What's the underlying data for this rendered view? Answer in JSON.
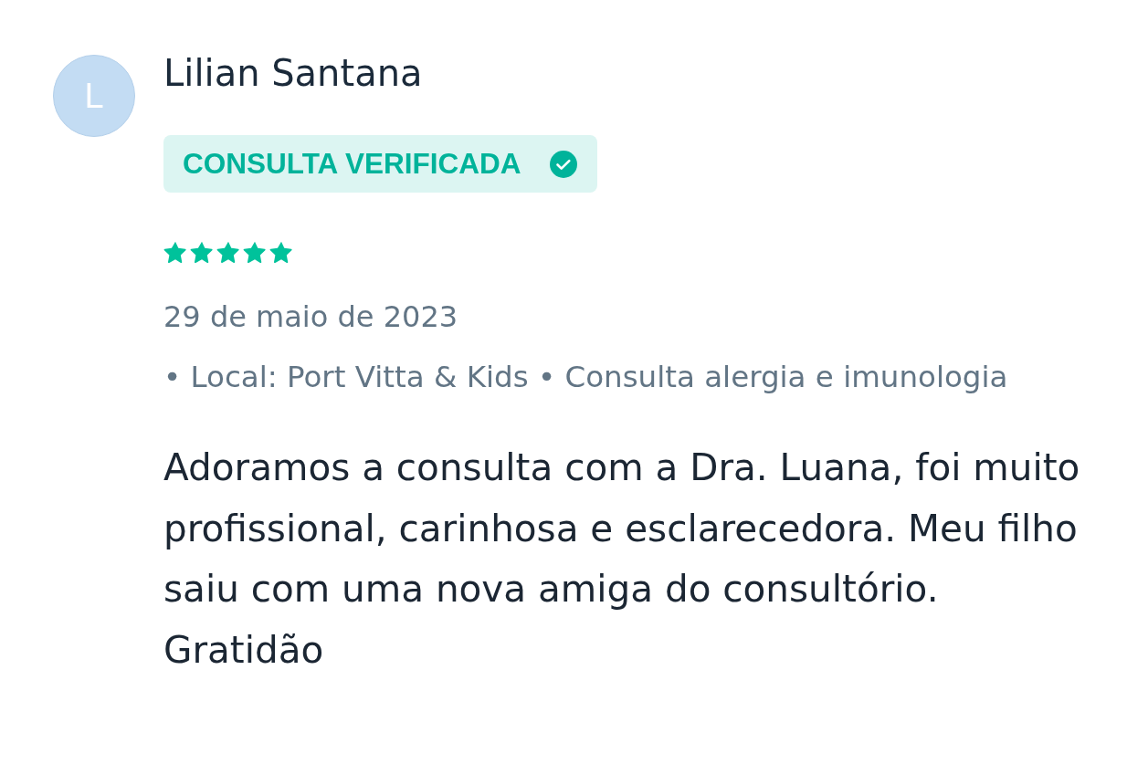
{
  "review": {
    "author": {
      "initial": "L",
      "name": "Lilian Santana"
    },
    "badge": {
      "label": "CONSULTA VERIFICADA"
    },
    "stars": 5,
    "date": "29 de maio de 2023",
    "details": "• Local: Port Vitta & Kids • Consulta alergia e imunologia",
    "text": "Adoramos a consulta com a Dra. Luana, foi muito profissional, carinhosa e esclarecedora. Meu filho saiu com uma nova amiga do consultório. Gratidão"
  }
}
